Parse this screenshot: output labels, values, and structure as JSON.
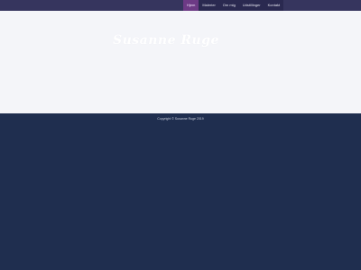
{
  "nav": {
    "items": [
      {
        "label": "Hjem",
        "active": true
      },
      {
        "label": "Malerier",
        "active": false
      },
      {
        "label": "Om mig",
        "active": false
      },
      {
        "label": "Udstillinger",
        "active": false
      },
      {
        "label": "Kontakt",
        "active": false
      }
    ]
  },
  "site": {
    "logo_text": "Susanne Ruge"
  },
  "footer": {
    "copyright": "Copyright © Susanne Ruge 2019"
  },
  "colors": {
    "page_bg": "#1f2e4f",
    "content_bg": "#f4f5f9",
    "nav_bg": "#2a2950",
    "active_bg": "#6d3a85"
  }
}
